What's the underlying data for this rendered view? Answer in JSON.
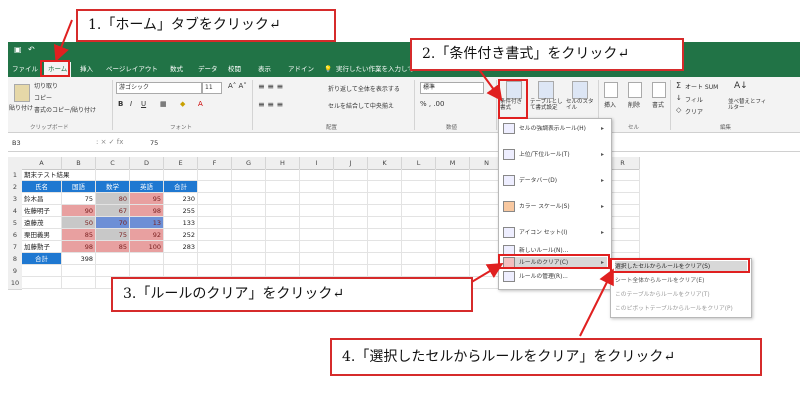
{
  "callouts": {
    "c1": "1.「ホーム」タブをクリック↵",
    "c2": "2.「条件付き書式」をクリック↵",
    "c3": "3.「ルールのクリア」をクリック↵",
    "c4": "4.「選択したセルからルールをクリア」をクリック↵"
  },
  "colors": {
    "accent": "#217346",
    "callout_border": "#d62b2b",
    "header_fill": "#1f78d1",
    "red_fill": "#e8a0a0",
    "gray_fill": "#c8c8c8",
    "blue_fill": "#6d8fd6"
  },
  "tabs": [
    "ファイル",
    "ホーム",
    "挿入",
    "ページレイアウト",
    "数式",
    "データ",
    "校閲",
    "表示",
    "アドイン"
  ],
  "tell_me": "実行したい作業を入力して",
  "ribbon": {
    "paste": "貼り付け",
    "cut": "切り取り",
    "copy": "コピー",
    "format_painter": "書式のコピー/貼り付け",
    "clipboard": "クリップボード",
    "font_name": "游ゴシック",
    "font_size": "11",
    "font_group": "フォント",
    "wrap": "折り返して全体を表示する",
    "merge": "セルを結合して中央揃え",
    "align_group": "配置",
    "num_format": "標準",
    "num_group": "数値",
    "cond_format": "条件付き書式",
    "table_format": "テーブルとして書式設定",
    "cell_style": "セルのスタイル",
    "insert": "挿入",
    "delete": "削除",
    "format": "書式",
    "cells_group": "セル",
    "autosum": "オート SUM",
    "fill": "フィル",
    "clear": "クリア",
    "sort": "並べ替えとフィルター",
    "edit_group": "編集"
  },
  "formula_bar": {
    "name_box": "B3",
    "value": "75"
  },
  "sheet": {
    "columns": [
      "A",
      "B",
      "C",
      "D",
      "E",
      "F",
      "G",
      "H",
      "I",
      "J",
      "K",
      "L",
      "M",
      "N",
      "O",
      "P",
      "Q",
      "R"
    ],
    "rows": [
      "1",
      "2",
      "3",
      "4",
      "5",
      "6",
      "7",
      "8",
      "9",
      "10"
    ],
    "title": "期末テスト結果",
    "headers": [
      "氏名",
      "国語",
      "数学",
      "英語",
      "合計"
    ],
    "data": [
      [
        "鈴木昌",
        "75",
        "80",
        "95",
        "230"
      ],
      [
        "佐藤明子",
        "90",
        "67",
        "98",
        "255"
      ],
      [
        "遠藤茂",
        "50",
        "70",
        "13",
        "133"
      ],
      [
        "栗田義男",
        "85",
        "75",
        "92",
        "252"
      ],
      [
        "加藤勲子",
        "98",
        "85",
        "100",
        "283"
      ]
    ],
    "total_label": "合計",
    "total_value": "398"
  },
  "menu": {
    "items": [
      "セルの強調表示ルール(H)",
      "上位/下位ルール(T)",
      "データバー(D)",
      "カラー スケール(S)",
      "アイコン セット(I)",
      "新しいルール(N)...",
      "ルールのクリア(C)",
      "ルールの管理(R)..."
    ],
    "submenu": [
      "選択したセルからルールをクリア(S)",
      "シート全体からルールをクリア(E)",
      "このテーブルからルールをクリア(T)",
      "このピボットテーブルからルールをクリア(P)"
    ]
  }
}
